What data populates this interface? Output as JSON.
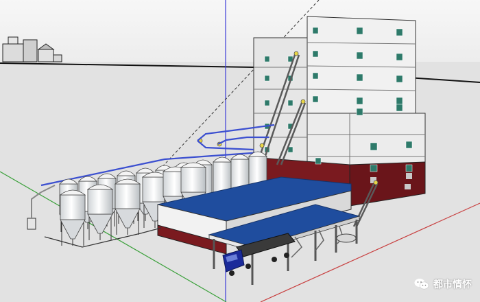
{
  "scene": {
    "model": "grain-storage-and-processing-plant",
    "colors": {
      "sky": "#f4f4f4",
      "ground": "#e4e4e4",
      "wall_light": "#efefef",
      "wall_shade": "#d4d4d4",
      "roof_blue": "#1f4d9e",
      "base_red": "#7a1a1f",
      "window": "#2e7a6a",
      "pipe_blue": "#3b4fd0",
      "truck": "#1a2a9a",
      "axis_red": "#c84040",
      "axis_green": "#3aa03a",
      "axis_blue": "#3a3ad8"
    },
    "icons": [
      "wechat-icon"
    ]
  },
  "watermark": {
    "text": "都市情怀"
  }
}
